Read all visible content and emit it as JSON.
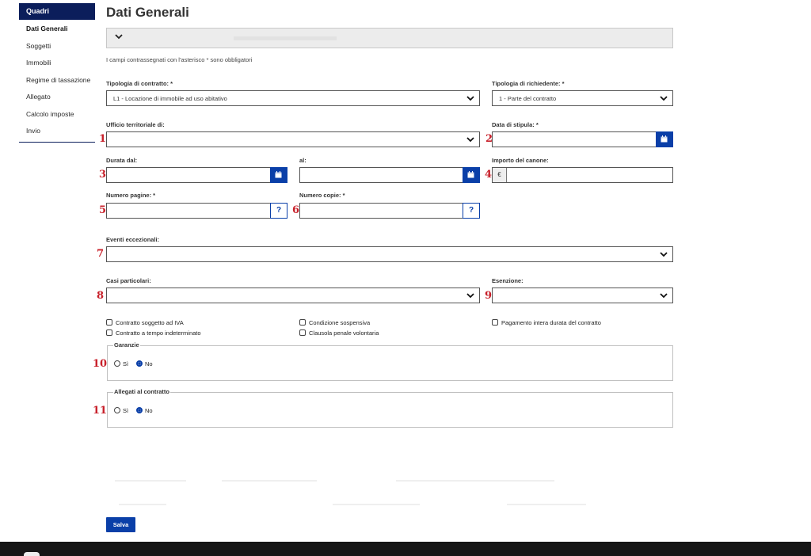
{
  "sidebar": {
    "header": "Quadri",
    "items": [
      {
        "label": "Dati Generali",
        "active": true
      },
      {
        "label": "Soggetti"
      },
      {
        "label": "Immobili"
      },
      {
        "label": "Regime di tassazione"
      },
      {
        "label": "Allegato"
      },
      {
        "label": "Calcolo imposte"
      },
      {
        "label": "Invio"
      }
    ]
  },
  "page": {
    "title": "Dati Generali",
    "mandatory_note": "I campi contrassegnati con l'asterisco * sono obbligatori"
  },
  "form": {
    "tipologia_contratto": {
      "label": "Tipologia di contratto: *",
      "value": "L1 - Locazione di immobile ad uso abitativo"
    },
    "tipologia_richiedente": {
      "label": "Tipologia di richiedente: *",
      "value": "1 - Parte del contratto"
    },
    "ufficio": {
      "label": "Ufficio territoriale di:",
      "value": ""
    },
    "data_stipula": {
      "label": "Data di stipula: *",
      "value": ""
    },
    "durata_dal": {
      "label": "Durata dal:",
      "value": ""
    },
    "durata_al": {
      "label": "al:",
      "value": ""
    },
    "importo": {
      "label": "Importo del canone:",
      "currency": "€",
      "value": ""
    },
    "numero_pagine": {
      "label": "Numero pagine: *",
      "value": ""
    },
    "numero_copie": {
      "label": "Numero copie: *",
      "value": ""
    },
    "help_label": "?",
    "eventi": {
      "label": "Eventi eccezionali:",
      "value": ""
    },
    "casi": {
      "label": "Casi particolari:",
      "value": ""
    },
    "esenzione": {
      "label": "Esenzione:",
      "value": ""
    },
    "checkboxes": {
      "iva": "Contratto soggetto ad IVA",
      "tempo_indeterminato": "Contratto a tempo indeterminato",
      "condizione_sospensiva": "Condizione sospensiva",
      "clausola_penale": "Clausola penale volontaria",
      "pagamento_intera": "Pagamento intera durata del contratto"
    },
    "garanzie": {
      "legend": "Garanzie",
      "yes": "Sì",
      "no": "No",
      "selected": "No"
    },
    "allegati": {
      "legend": "Allegati al contratto",
      "yes": "Sì",
      "no": "No",
      "selected": "No"
    }
  },
  "annotations": [
    "1",
    "2",
    "3",
    "4",
    "5",
    "6",
    "7",
    "8",
    "9",
    "10",
    "11"
  ],
  "actions": {
    "save_label": "Salva"
  },
  "colors": {
    "primary": "#0a3fa8",
    "sidebar_header": "#0b1e5b",
    "annotation": "#c8202a"
  }
}
